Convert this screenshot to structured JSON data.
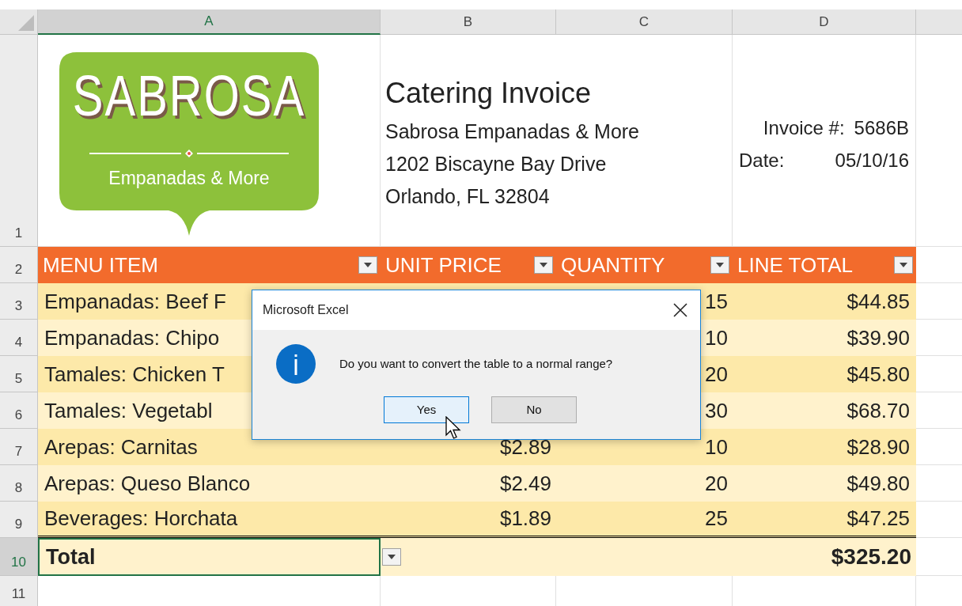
{
  "column_headers": [
    {
      "label": "A",
      "selected": true
    },
    {
      "label": "B",
      "selected": false
    },
    {
      "label": "C",
      "selected": false
    },
    {
      "label": "D",
      "selected": false
    }
  ],
  "invoice": {
    "row_number": "1",
    "logo": {
      "title": "SABROSA",
      "tagline": "Empanadas & More"
    },
    "title": "Catering Invoice",
    "address_lines": [
      "Sabrosa Empanadas & More",
      "1202 Biscayne Bay Drive",
      "Orlando, FL 32804"
    ],
    "invoice_label": "Invoice #:",
    "invoice_value": "5686B",
    "date_label": "Date:",
    "date_value": "05/10/16"
  },
  "table": {
    "header_row_number": "2",
    "columns": [
      {
        "label": "MENU ITEM"
      },
      {
        "label": "UNIT PRICE"
      },
      {
        "label": "QUANTITY"
      },
      {
        "label": "LINE TOTAL"
      }
    ],
    "rows": [
      {
        "number": "3",
        "item": "Empanadas: Beef F",
        "quantity": "15",
        "line_total": "$44.85"
      },
      {
        "number": "4",
        "item": "Empanadas: Chipo",
        "quantity": "10",
        "line_total": "$39.90"
      },
      {
        "number": "5",
        "item": "Tamales: Chicken T",
        "quantity": "20",
        "line_total": "$45.80"
      },
      {
        "number": "6",
        "item": "Tamales: Vegetabl",
        "quantity": "30",
        "line_total": "$68.70"
      },
      {
        "number": "7",
        "item": "Arepas: Carnitas",
        "unit_price": "$2.89",
        "quantity": "10",
        "line_total": "$28.90"
      },
      {
        "number": "8",
        "item": "Arepas: Queso Blanco",
        "unit_price": "$2.49",
        "quantity": "20",
        "line_total": "$49.80"
      },
      {
        "number": "9",
        "item": "Beverages: Horchata",
        "unit_price": "$1.89",
        "quantity": "25",
        "line_total": "$47.25"
      }
    ],
    "total_row": {
      "number": "10",
      "label": "Total",
      "value": "$325.20",
      "selected": true
    }
  },
  "empty_row": {
    "number": "11"
  },
  "dialog": {
    "title": "Microsoft Excel",
    "message": "Do you want to convert the table to a normal range?",
    "buttons": [
      {
        "label": "Yes",
        "selected": true
      },
      {
        "label": "No",
        "selected": false
      }
    ]
  }
}
